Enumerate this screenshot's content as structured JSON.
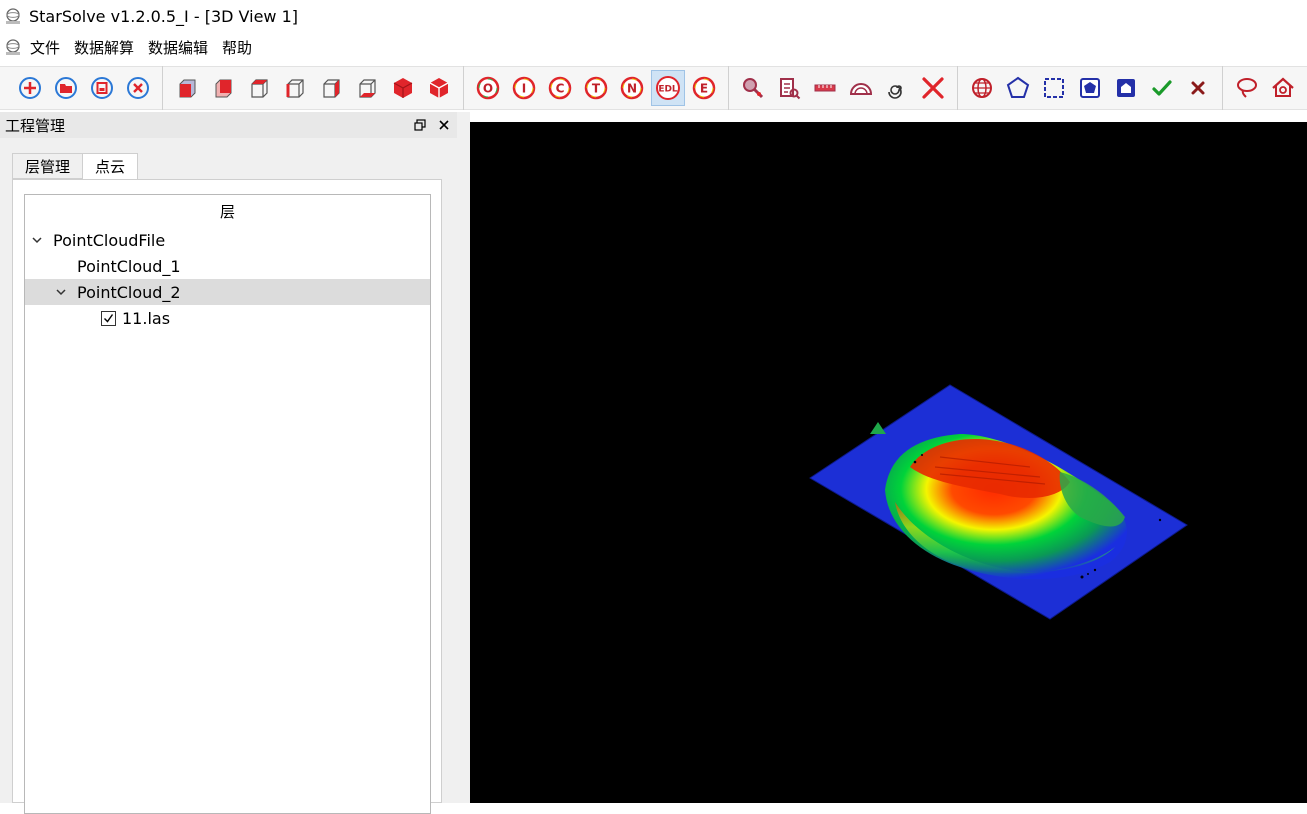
{
  "window": {
    "title": "StarSolve v1.2.0.5_I - [3D View 1]"
  },
  "menubar": {
    "items": [
      {
        "name": "menu-file",
        "label": "文件"
      },
      {
        "name": "menu-data-solve",
        "label": "数据解算"
      },
      {
        "name": "menu-data-edit",
        "label": "数据编辑"
      },
      {
        "name": "menu-help",
        "label": "帮助"
      }
    ]
  },
  "toolbar": {
    "active_button": "edl",
    "groups": [
      [
        "new-project",
        "open-project",
        "save-project",
        "close-project"
      ],
      [
        "view-front-solid",
        "view-back-solid",
        "view-top-wire",
        "view-left-wire",
        "view-right-wire",
        "view-bottom-wire",
        "view-iso-solid",
        "view-iso-split"
      ],
      [
        "mode-o",
        "mode-i",
        "mode-c",
        "mode-t",
        "mode-n",
        "edl",
        "mode-e"
      ],
      [
        "point-pick",
        "point-info",
        "measure-distance",
        "measure-angle",
        "rotate-tool",
        "delete-tool"
      ],
      [
        "sphere-select",
        "polygon-select",
        "rect-select",
        "polygon-fill",
        "home-select",
        "confirm",
        "cancel"
      ],
      [
        "lasso",
        "home-view"
      ]
    ]
  },
  "project_panel": {
    "title": "工程管理",
    "tabs": [
      {
        "label": "层管理",
        "active": false
      },
      {
        "label": "点云",
        "active": true
      }
    ],
    "tree": {
      "header": "层",
      "root": "PointCloudFile",
      "children": [
        {
          "label": "PointCloud_1"
        },
        {
          "label": "PointCloud_2",
          "selected": true,
          "files": [
            {
              "label": "11.las",
              "checked": true
            }
          ]
        }
      ]
    }
  },
  "viewport": {
    "background": "#000000",
    "colormap": [
      "#1a2ee0",
      "#00d33a",
      "#f5f500",
      "#ff2a00"
    ]
  }
}
